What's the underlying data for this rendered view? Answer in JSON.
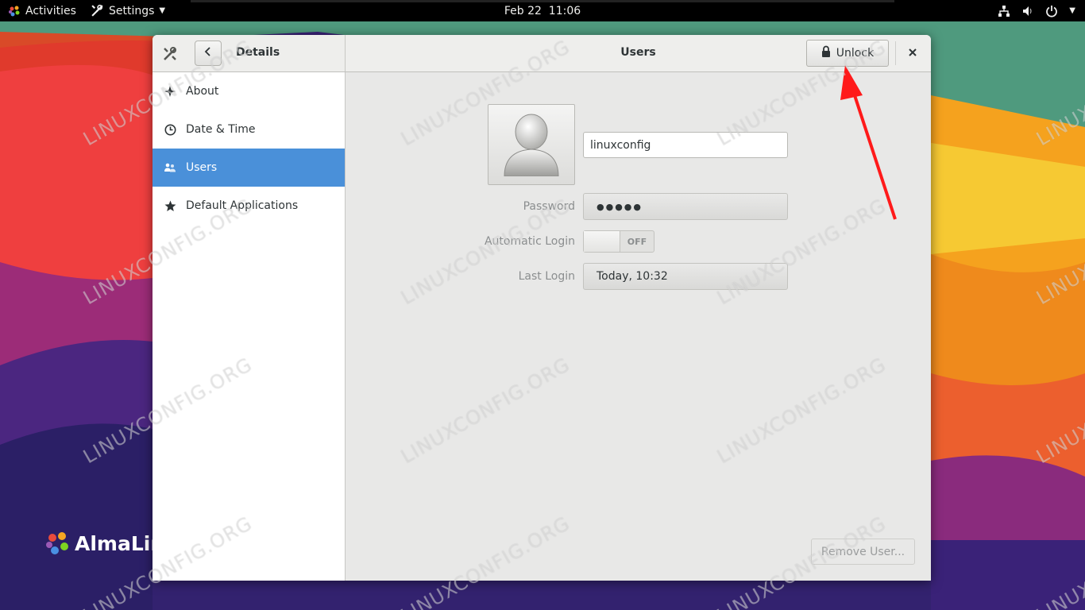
{
  "topbar": {
    "activities_label": "Activities",
    "app_menu_label": "Settings",
    "clock": "Feb 22  11:06"
  },
  "desktop": {
    "logo_text": "AlmaLin"
  },
  "window": {
    "left_title": "Details",
    "title": "Users",
    "unlock_label": "Unlock"
  },
  "sidebar": {
    "items": [
      {
        "label": "About",
        "icon": "sparkle-icon"
      },
      {
        "label": "Date & Time",
        "icon": "clock-icon"
      },
      {
        "label": "Users",
        "icon": "users-icon",
        "selected": true
      },
      {
        "label": "Default Applications",
        "icon": "star-icon"
      }
    ]
  },
  "user": {
    "username": "linuxconfig",
    "password_label": "Password",
    "password_value": "●●●●●",
    "autologin_label": "Automatic Login",
    "autologin_state": "OFF",
    "lastlogin_label": "Last Login",
    "lastlogin_value": "Today, 10:32",
    "remove_label": "Remove User..."
  },
  "watermark_text": "LINUXCONFIG.ORG",
  "colors": {
    "selection": "#4a90d9",
    "arrow": "#ff1a1a",
    "topbar": "#000000"
  }
}
